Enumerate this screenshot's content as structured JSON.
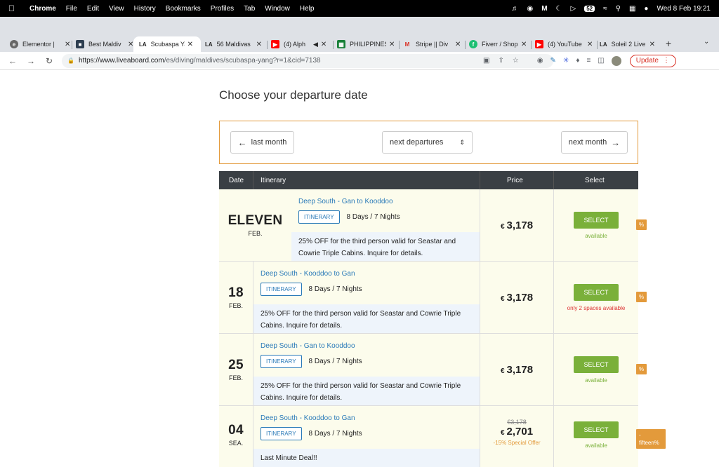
{
  "menubar": {
    "apple_icon": "apple-icon",
    "app_name": "Chrome",
    "items": [
      "File",
      "Edit",
      "View",
      "History",
      "Bookmarks",
      "Profiles",
      "Tab",
      "Window",
      "Help"
    ],
    "battery": "52",
    "datetime": "Wed 8 Feb  19:21"
  },
  "tabs": [
    {
      "title": "Elementor |",
      "icon": "elementor-icon"
    },
    {
      "title": "Best Maldiv",
      "icon": "shield-icon"
    },
    {
      "title": "Scubaspa Ya",
      "icon": "LA",
      "active": true
    },
    {
      "title": "56 Maldivas",
      "icon": "LA"
    },
    {
      "title": "(4) Alph",
      "icon": "youtube-icon"
    },
    {
      "title": "PHILIPPINES",
      "icon": "sheets-icon"
    },
    {
      "title": "Stripe || Div",
      "icon": "gmail-icon"
    },
    {
      "title": "Fiverr / Shop",
      "icon": "fiverr-icon"
    },
    {
      "title": "(4) YouTube",
      "icon": "youtube-icon"
    },
    {
      "title": "Soleil 2 Live",
      "icon": "LA"
    }
  ],
  "address": {
    "host": "https://www.liveaboard.com",
    "path": "/es/diving/maldives/scubaspa-yang?r=1&cid=7138",
    "update_label": "Update"
  },
  "page": {
    "title": "Choose your departure date",
    "last_month": "last month",
    "next_departures": "next departures",
    "next_month": "next month",
    "headers": {
      "date": "Date",
      "itinerary": "Itinerary",
      "price": "Price",
      "select": "Select"
    }
  },
  "rows": [
    {
      "day": "ELEVEN",
      "month": "FEB.",
      "route": "Deep South - Gan to Kooddoo",
      "tag": "ITINERARY",
      "nights": "8 Days / 7 Nights",
      "promo": "25% OFF for the third person valid for Seastar and Cowrie Triple Cabins. Inquire for details.",
      "currency": "€",
      "price": "3,178",
      "old_price": "",
      "offer": "",
      "select": "SELECT",
      "availability": "available",
      "low": false,
      "discount": "%"
    },
    {
      "day": "18",
      "month": "FEB.",
      "route": "Deep South - Kooddoo to Gan",
      "tag": "ITINERARY",
      "nights": "8 Days / 7 Nights",
      "promo": "25% OFF for the third person valid for Seastar and Cowrie Triple Cabins. Inquire for details.",
      "currency": "€",
      "price": "3,178",
      "old_price": "",
      "offer": "",
      "select": "SELECT",
      "availability": "only 2 spaces available",
      "low": true,
      "discount": "%"
    },
    {
      "day": "25",
      "month": "FEB.",
      "route": "Deep South - Gan to Kooddoo",
      "tag": "ITINERARY",
      "nights": "8 Days / 7 Nights",
      "promo": "25% OFF for the third person valid for Seastar and Cowrie Triple Cabins. Inquire for details.",
      "currency": "€",
      "price": "3,178",
      "old_price": "",
      "offer": "",
      "select": "SELECT",
      "availability": "available",
      "low": false,
      "discount": "%"
    },
    {
      "day": "04",
      "month": "SEA.",
      "route": "Deep South - Kooddoo to Gan",
      "tag": "ITINERARY",
      "nights": "8 Days / 7 Nights",
      "promo": "Last Minute Deal!!",
      "currency": "€",
      "price": "2,701",
      "old_price": "€3,178",
      "offer": "-15% Special Offer",
      "select": "SELECT",
      "availability": "available",
      "low": false,
      "discount": "-\nfifteen%"
    }
  ],
  "colors": {
    "accent": "#e39a3b",
    "select_green": "#7ab03a",
    "link_blue": "#2a7ab8",
    "header_dark": "#3a3f44"
  }
}
